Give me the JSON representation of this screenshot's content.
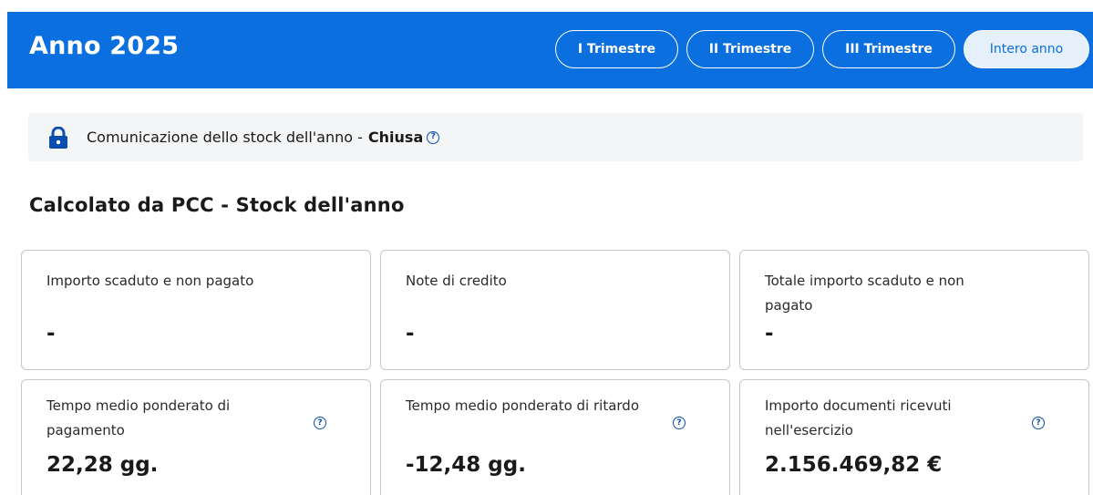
{
  "header": {
    "title": "Anno 2025",
    "tabs": [
      {
        "label": "I Trimestre",
        "active": false
      },
      {
        "label": "II Trimestre",
        "active": false
      },
      {
        "label": "III Trimestre",
        "active": false
      },
      {
        "label": "Intero anno",
        "active": true
      }
    ]
  },
  "status": {
    "icon": "lock-icon",
    "text": "Comunicazione dello stock dell'anno -",
    "state": "Chiusa",
    "help_icon": "help-icon"
  },
  "section": {
    "title": "Calcolato da PCC - Stock dell'anno"
  },
  "cards": [
    {
      "label": "Importo scaduto e non pagato",
      "value": "-"
    },
    {
      "label": "Note di credito",
      "value": "-"
    },
    {
      "label": "Totale importo scaduto e non pagato",
      "value": "-"
    },
    {
      "label": "Tempo medio ponderato di pagamento",
      "value": "22,28 gg.",
      "help": true
    },
    {
      "label": "Tempo medio ponderato di ritardo",
      "value": "-12,48 gg.",
      "help": true
    },
    {
      "label": "Importo documenti ricevuti nell'esercizio",
      "value": "2.156.469,82 €",
      "help": true
    }
  ],
  "colors": {
    "header_bg": "#0b6fe0",
    "status_bg": "#f4f5f6",
    "help_icon": "#0b4fae"
  }
}
